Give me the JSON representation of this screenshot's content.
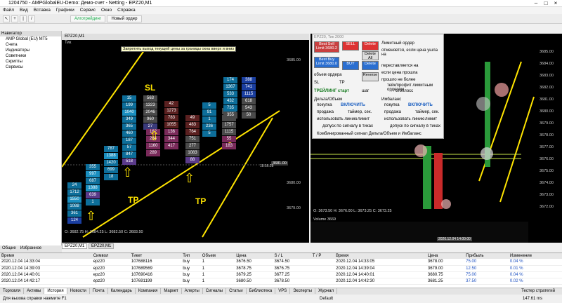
{
  "window": {
    "title": "1204750 - AMPGlobalEU-Demo: Демо-счет - Netting - EPZ20,M1"
  },
  "menu": [
    "Файл",
    "Вид",
    "Вставка",
    "Графики",
    "Сервис",
    "Окно",
    "Справка"
  ],
  "toolbar": {
    "algo": "Алготрейдинг",
    "new_order": "Новый ордер"
  },
  "navigator": {
    "title": "Навигатор",
    "items": [
      "AMP Global (EU) MT5",
      "Счета",
      "Индикаторы",
      "Советники",
      "Скрипты",
      "Сервисы"
    ],
    "tabs": [
      "Общие",
      "Избранное"
    ]
  },
  "chart1": {
    "title": "EPZ20,M1",
    "tooltip": "Запретить выход текущей цены за границы окна вверх и вниз",
    "tf": "Тик",
    "labels": [
      "SL",
      "TP",
      "TP"
    ],
    "price_axis": [
      "3685.00",
      "3681.00",
      "3680.00",
      "3679.00"
    ],
    "ohlc": "O: 3682.75  H: 3684.25  L: 3682.50  C: 3683.50",
    "time": "18:56:28"
  },
  "chart2": {
    "title": "EPZ20, Тик  2000",
    "ohlc": "O: 3673.50  H: 3676.00  L: 3673.25  C: 3673.25",
    "volume": "Volume 3669",
    "price_axis": [
      "3685.00",
      "3684.00",
      "3683.00",
      "3682.00",
      "3681.00",
      "3680.00",
      "3679.00",
      "3678.00",
      "3677.00",
      "3676.00",
      "3675.00",
      "3674.00",
      "3673.00",
      "3672.00"
    ],
    "date": "2020.12.04 14:00:00"
  },
  "panel": {
    "buttons": [
      "Best Sell Limit 3680.2",
      "SELL",
      "Delete",
      "Best Buy Limit 3680.0",
      "BUY",
      "Delete All",
      "Delete",
      "Reverse"
    ],
    "left_labels": [
      "объем ордера",
      "SL",
      "TP",
      "ТРЕЙЛИНГ старт",
      "шаг"
    ],
    "right_labels": [
      "Лимитный ордер",
      "отменяется, если цена ушла на",
      "тиков",
      "переставляется на",
      "тиков",
      "если цена прошла",
      "тиков и",
      "прошло не более",
      "сек",
      "тейк/профит лимитным ордером",
      "стоплосс"
    ],
    "section_delta": "Дельта/Объем",
    "section_imb": "Имбаланс",
    "enable": "ВКЛЮЧИТЬ",
    "buy": "покупка",
    "sell": "продажа",
    "timer": "таймер, сек.",
    "use_line": "использовать линию",
    "limit": "лимит",
    "admit": "допуск по сигналу в тиках",
    "combined": "Комбинированный сигнал Дельта/Объем и Имбаланс"
  },
  "bottom": {
    "headers": [
      "Время",
      "Символ",
      "Тикет",
      "Тип",
      "Объем",
      "Цена",
      "S / L",
      "T / P",
      "Время",
      "Цена",
      "Прибыль",
      "Изменение"
    ],
    "rows": [
      [
        "2020.12.04 14:33:04",
        "epz20",
        "107688116",
        "buy",
        "1",
        "3676.50",
        "3674.50",
        "",
        "2020.12.04 14:33:05",
        "3678.00",
        "75.00",
        "0.04 %"
      ],
      [
        "2020.12.04 14:39:03",
        "epz20",
        "107689569",
        "buy",
        "1",
        "3678.75",
        "3676.75",
        "",
        "2020.12.04 14:39:04",
        "3679.00",
        "12.50",
        "0.01 %"
      ],
      [
        "2020.12.04 14:40:01",
        "epz20",
        "107690416",
        "buy",
        "1",
        "3679.25",
        "3677.25",
        "",
        "2020.12.04 14:40:01",
        "3680.75",
        "75.00",
        "0.04 %"
      ],
      [
        "2020.12.04 14:42:17",
        "epz20",
        "107691199",
        "buy",
        "1",
        "3680.50",
        "3678.50",
        "",
        "2020.12.04 14:42:30",
        "3681.25",
        "37.50",
        "0.02 %"
      ]
    ],
    "tabs": [
      "Торговля",
      "Активы",
      "История",
      "Новости",
      "Почта",
      "Календарь",
      "Компания",
      "Маркет",
      "Алерты",
      "Сигналы",
      "Статьи",
      "Библиотека",
      "VPS",
      "Эксперты",
      "Журнал"
    ],
    "chart_tabs": [
      "EPZ20,M1",
      "EPZ20,M1"
    ],
    "tester": "Тестер стратегий"
  },
  "status": {
    "help": "Для вызова справки нажмите F1",
    "profile": "Default",
    "ping": "147.61 ms"
  }
}
